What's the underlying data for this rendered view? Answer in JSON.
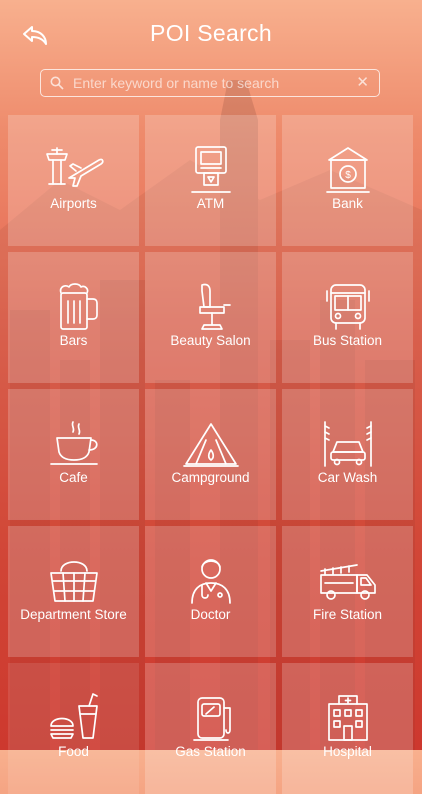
{
  "header": {
    "title": "POI Search"
  },
  "search": {
    "placeholder": "Enter keyword or name to search",
    "value": ""
  },
  "categories": [
    {
      "label": "Airports",
      "icon": "airport-icon"
    },
    {
      "label": "ATM",
      "icon": "atm-icon"
    },
    {
      "label": "Bank",
      "icon": "bank-icon"
    },
    {
      "label": "Bars",
      "icon": "beer-mug-icon"
    },
    {
      "label": "Beauty Salon",
      "icon": "salon-chair-icon"
    },
    {
      "label": "Bus Station",
      "icon": "bus-icon"
    },
    {
      "label": "Cafe",
      "icon": "coffee-cup-icon"
    },
    {
      "label": "Campground",
      "icon": "tent-icon"
    },
    {
      "label": "Car Wash",
      "icon": "car-wash-icon"
    },
    {
      "label": "Department Store",
      "icon": "shopping-basket-icon"
    },
    {
      "label": "Doctor",
      "icon": "doctor-icon"
    },
    {
      "label": "Fire Station",
      "icon": "fire-truck-icon"
    },
    {
      "label": "Food",
      "icon": "fast-food-icon"
    },
    {
      "label": "Gas Station",
      "icon": "gas-pump-icon"
    },
    {
      "label": "Hospital",
      "icon": "hospital-icon"
    }
  ]
}
